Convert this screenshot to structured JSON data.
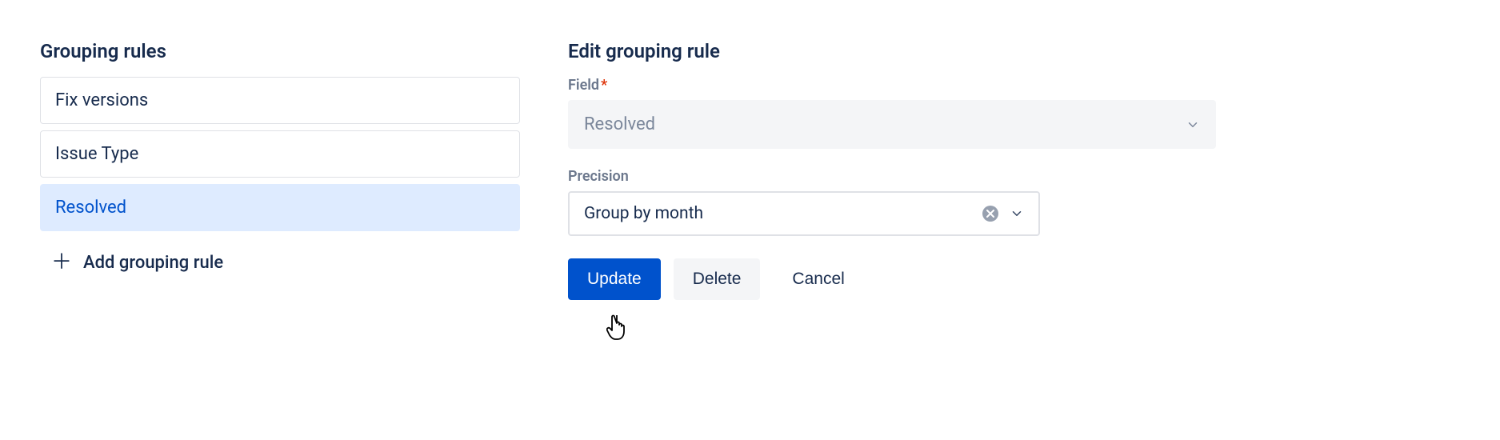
{
  "left": {
    "title": "Grouping rules",
    "rules": [
      {
        "label": "Fix versions",
        "selected": false
      },
      {
        "label": "Issue Type",
        "selected": false
      },
      {
        "label": "Resolved",
        "selected": true
      }
    ],
    "add_label": "Add grouping rule"
  },
  "right": {
    "title": "Edit grouping rule",
    "field_label": "Field",
    "field_value": "Resolved",
    "precision_label": "Precision",
    "precision_value": "Group by month",
    "buttons": {
      "update": "Update",
      "delete": "Delete",
      "cancel": "Cancel"
    }
  }
}
